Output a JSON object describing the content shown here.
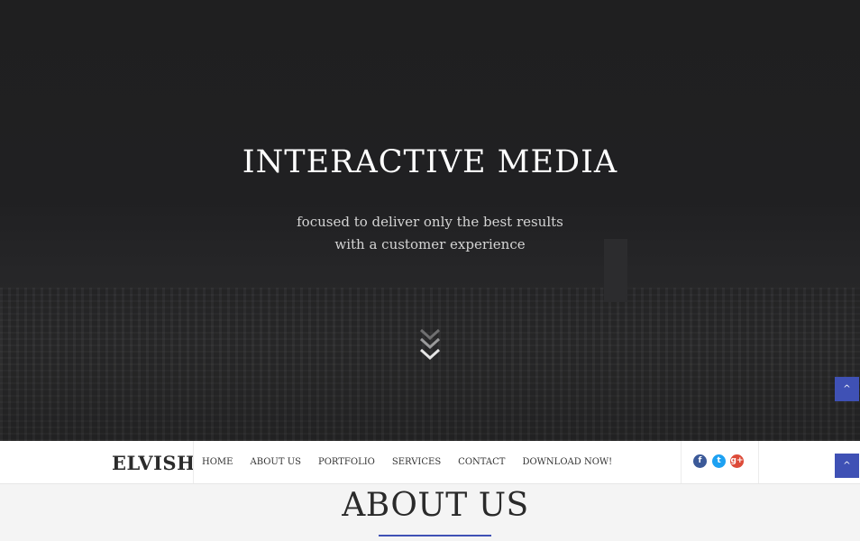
{
  "hero": {
    "title": "INTERACTIVE MEDIA",
    "subtitle_line1": "focused to deliver only the best results",
    "subtitle_line2": "with a customer experience",
    "scroll_icon": "double-chevron-down-icon"
  },
  "nav": {
    "logo": "ELVISH",
    "items": [
      {
        "label": "HOME"
      },
      {
        "label": "ABOUT US"
      },
      {
        "label": "PORTFOLIO"
      },
      {
        "label": "SERVICES"
      },
      {
        "label": "CONTACT"
      },
      {
        "label": "DOWNLOAD NOW!"
      }
    ],
    "social": {
      "facebook": "f",
      "twitter": "t",
      "google_plus": "g+"
    }
  },
  "back_to_top": "^",
  "section": {
    "title": "ABOUT US"
  },
  "colors": {
    "accent": "#3f51b5",
    "facebook": "#3b5998",
    "twitter": "#1da1f2",
    "google_plus": "#dd4b39"
  }
}
